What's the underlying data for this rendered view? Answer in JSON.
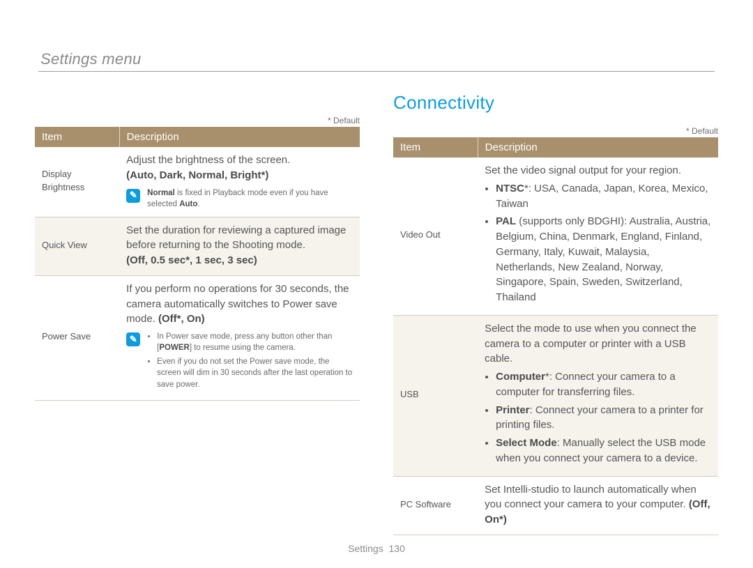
{
  "breadcrumb": "Settings menu",
  "default_note": "* Default",
  "section_title": "Connectivity",
  "headers": {
    "item": "Item",
    "description": "Description"
  },
  "left_table": [
    {
      "item": "Display Brightness",
      "desc_intro": "Adjust the brightness of the screen.",
      "options": "(Auto, Dark, Normal, Bright*)",
      "note": {
        "type": "single",
        "text_pre": "Normal",
        "text_post": " is fixed in Playback mode even if you have selected ",
        "text_bold2": "Auto",
        "text_end": "."
      }
    },
    {
      "item": "Quick View",
      "desc_intro": "Set the duration for reviewing a captured image before returning to the Shooting mode.",
      "options": "(Off, 0.5 sec*, 1 sec, 3 sec)"
    },
    {
      "item": "Power Save",
      "desc_intro": "If you perform no operations for 30 seconds, the camera automatically switches to Power save mode. ",
      "options_inline": "(Off*, On)",
      "note": {
        "type": "list",
        "items": [
          {
            "pre": "In Power save mode, press any button other than [",
            "bold": "POWER",
            "post": "] to resume using the camera."
          },
          {
            "pre": "Even if you do not set the Power save mode, the screen will dim in 30 seconds after the last operation to save power."
          }
        ]
      }
    }
  ],
  "right_table": [
    {
      "item": "Video Out",
      "desc_intro": "Set the video signal output for your region.",
      "bullets": [
        {
          "bold": "NTSC",
          "star": "*",
          "post": ": USA, Canada, Japan, Korea, Mexico, Taiwan"
        },
        {
          "bold": "PAL",
          "paren": " (supports only BDGHI)",
          "post": ": Australia, Austria, Belgium, China, Denmark, England, Finland, Germany, Italy, Kuwait, Malaysia, Netherlands, New Zealand, Norway, Singapore, Spain, Sweden, Switzerland, Thailand"
        }
      ]
    },
    {
      "item": "USB",
      "desc_intro": "Select the mode to use when you connect the camera to a computer or printer with a USB cable.",
      "bullets": [
        {
          "bold": "Computer",
          "star": "*",
          "post": ": Connect your camera to a computer for transferring files."
        },
        {
          "bold": "Printer",
          "post": ": Connect your camera to a printer for printing files."
        },
        {
          "bold": "Select Mode",
          "post": ": Manually select the USB mode when you connect your camera to a device."
        }
      ]
    },
    {
      "item": "PC Software",
      "desc_intro": "Set Intelli-studio to launch automatically when you connect your camera to your computer. ",
      "options_inline": "(Off, On*)"
    }
  ],
  "footer": {
    "label": "Settings",
    "page": "130"
  }
}
